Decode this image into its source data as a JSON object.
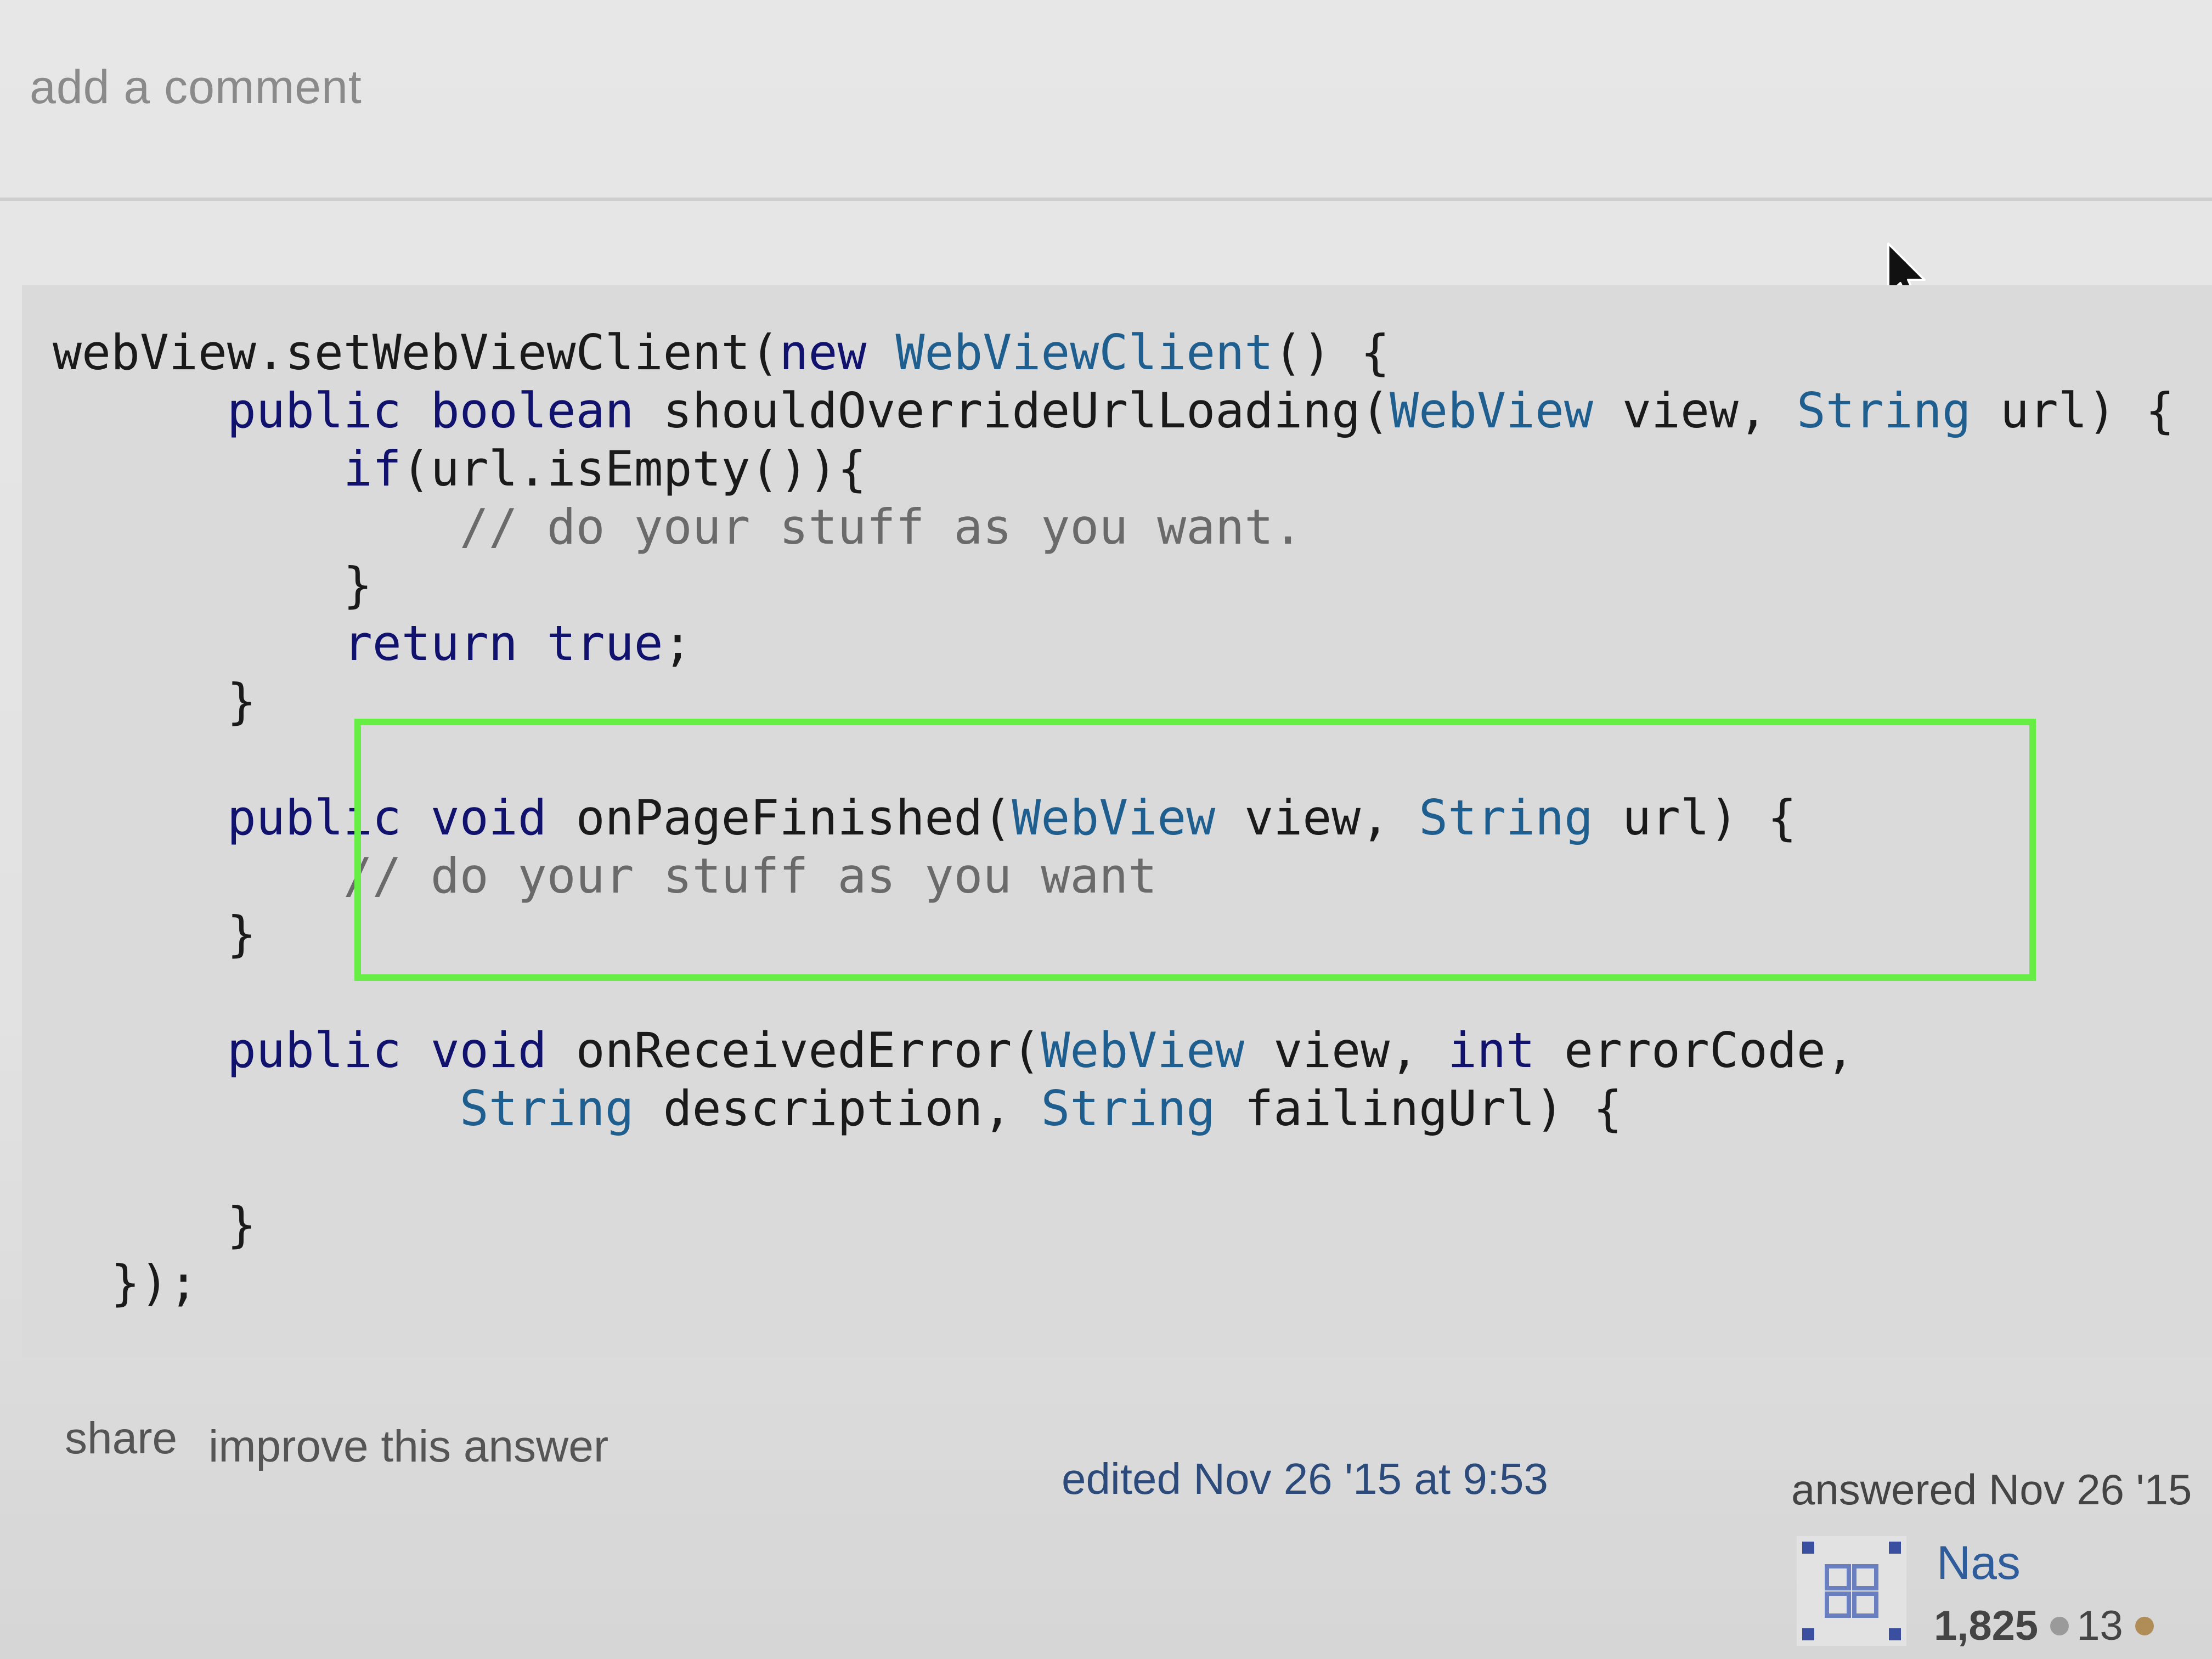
{
  "comment": {
    "add_label": "add a comment"
  },
  "code_lines": [
    [
      {
        "t": "webView.setWebViewClient(",
        "c": ""
      },
      {
        "t": "new",
        "c": "kw"
      },
      {
        "t": " ",
        "c": ""
      },
      {
        "t": "WebViewClient",
        "c": "ty"
      },
      {
        "t": "() {",
        "c": ""
      }
    ],
    [
      {
        "t": "      ",
        "c": ""
      },
      {
        "t": "public boolean",
        "c": "kw"
      },
      {
        "t": " shouldOverrideUrlLoading(",
        "c": ""
      },
      {
        "t": "WebView",
        "c": "ty"
      },
      {
        "t": " view, ",
        "c": ""
      },
      {
        "t": "String",
        "c": "ty"
      },
      {
        "t": " url) {",
        "c": ""
      }
    ],
    [
      {
        "t": "          ",
        "c": ""
      },
      {
        "t": "if",
        "c": "kw"
      },
      {
        "t": "(url.isEmpty()){",
        "c": ""
      }
    ],
    [
      {
        "t": "              ",
        "c": ""
      },
      {
        "t": "// do your stuff as you want.",
        "c": "cm"
      }
    ],
    [
      {
        "t": "          }",
        "c": ""
      }
    ],
    [
      {
        "t": "          ",
        "c": ""
      },
      {
        "t": "return true",
        "c": "kw"
      },
      {
        "t": ";",
        "c": ""
      }
    ],
    [
      {
        "t": "      }",
        "c": ""
      }
    ],
    [
      {
        "t": "",
        "c": ""
      }
    ],
    [
      {
        "t": "      ",
        "c": ""
      },
      {
        "t": "public void",
        "c": "kw"
      },
      {
        "t": " onPageFinished(",
        "c": ""
      },
      {
        "t": "WebView",
        "c": "ty"
      },
      {
        "t": " view, ",
        "c": ""
      },
      {
        "t": "String",
        "c": "ty"
      },
      {
        "t": " url) {",
        "c": ""
      }
    ],
    [
      {
        "t": "          ",
        "c": ""
      },
      {
        "t": "// do your stuff as you want",
        "c": "cm"
      }
    ],
    [
      {
        "t": "      }",
        "c": ""
      }
    ],
    [
      {
        "t": "",
        "c": ""
      }
    ],
    [
      {
        "t": "      ",
        "c": ""
      },
      {
        "t": "public void",
        "c": "kw"
      },
      {
        "t": " onReceivedError(",
        "c": ""
      },
      {
        "t": "WebView",
        "c": "ty"
      },
      {
        "t": " view, ",
        "c": ""
      },
      {
        "t": "int",
        "c": "kw"
      },
      {
        "t": " errorCode,",
        "c": ""
      }
    ],
    [
      {
        "t": "              ",
        "c": ""
      },
      {
        "t": "String",
        "c": "ty"
      },
      {
        "t": " description, ",
        "c": ""
      },
      {
        "t": "String",
        "c": "ty"
      },
      {
        "t": " failingUrl) {",
        "c": ""
      }
    ],
    [
      {
        "t": "",
        "c": ""
      }
    ],
    [
      {
        "t": "      }",
        "c": ""
      }
    ],
    [
      {
        "t": "  });",
        "c": ""
      }
    ]
  ],
  "footer": {
    "share_label": "share",
    "improve_label": "improve this answer",
    "edited_label": "edited Nov 26 '15 at 9:53",
    "answered_label": "answered Nov 26 '15",
    "user_name": "Nas",
    "reputation": "1,825",
    "silver_badges": "13"
  },
  "colors": {
    "highlight": "#66ee44",
    "keyword": "#10126e",
    "type": "#1f5f8f",
    "comment": "#6a6a6a",
    "link": "#2f5c9a"
  }
}
